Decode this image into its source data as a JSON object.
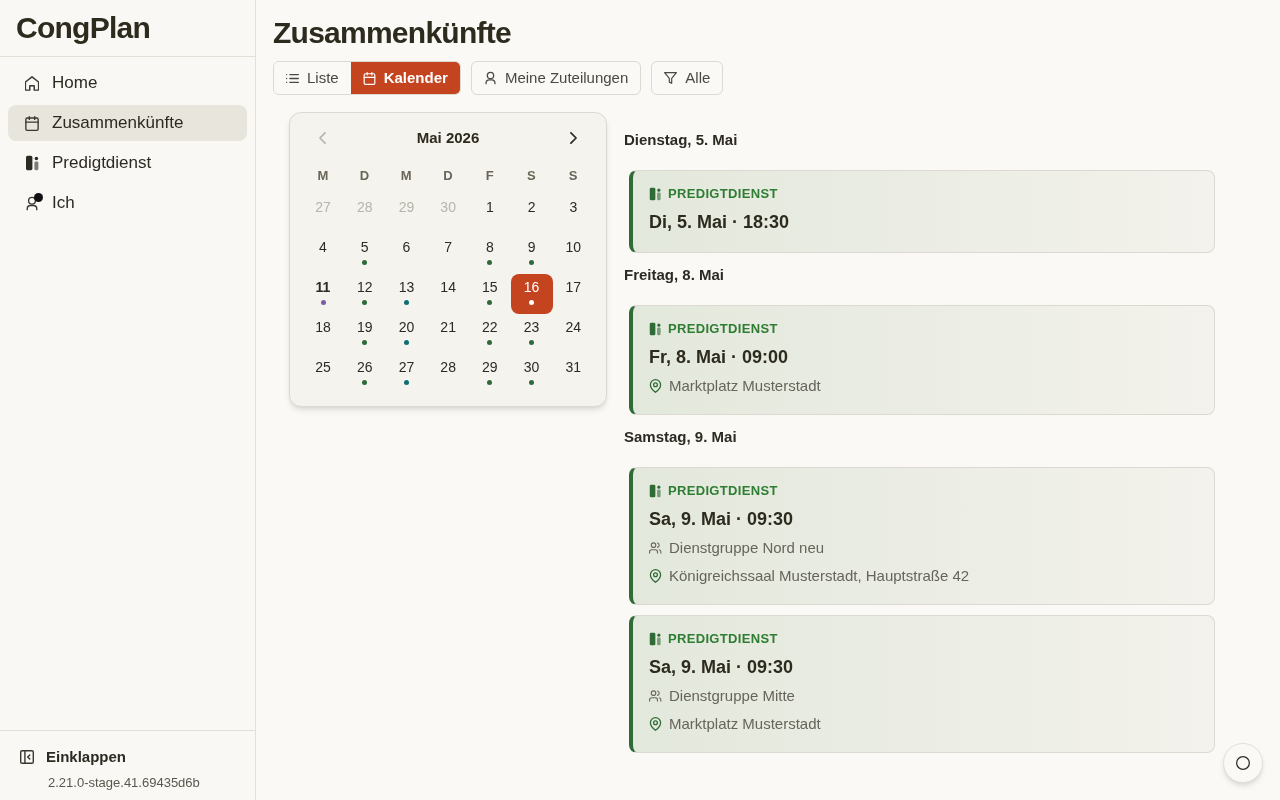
{
  "sidebar": {
    "app_title": "CongPlan",
    "items": [
      {
        "label": "Home",
        "selected": false,
        "notification": false
      },
      {
        "label": "Zusammenkünfte",
        "selected": true,
        "notification": false
      },
      {
        "label": "Predigtdienst",
        "selected": false,
        "notification": false
      },
      {
        "label": "Ich",
        "selected": false,
        "notification": true
      }
    ],
    "collapse_label": "Einklappen",
    "version": "2.21.0-stage.41.69435d6b"
  },
  "page": {
    "title": "Zusammenkünfte"
  },
  "toolbar": {
    "view_toggle": [
      {
        "label": "Liste",
        "selected": false
      },
      {
        "label": "Kalender",
        "selected": true
      }
    ],
    "buttons": [
      {
        "label": "Meine Zuteilungen"
      },
      {
        "label": "Alle"
      }
    ]
  },
  "calendar": {
    "month": "Mai 2026",
    "previous_disabled": true,
    "weekdays": [
      "M",
      "D",
      "M",
      "D",
      "F",
      "S",
      "S"
    ],
    "weeks": [
      [
        {
          "day": "27",
          "outside": true,
          "today": false,
          "selected": false
        },
        {
          "day": "28",
          "outside": true,
          "today": false,
          "selected": false
        },
        {
          "day": "29",
          "outside": true,
          "today": false,
          "selected": false
        },
        {
          "day": "30",
          "outside": true,
          "today": false,
          "selected": false
        },
        {
          "day": "1",
          "outside": false,
          "today": false,
          "selected": false
        },
        {
          "day": "2",
          "outside": false,
          "today": false,
          "selected": false
        },
        {
          "day": "3",
          "outside": false,
          "today": false,
          "selected": false
        }
      ],
      [
        {
          "day": "4",
          "outside": false,
          "today": false,
          "selected": false
        },
        {
          "day": "5",
          "outside": false,
          "today": false,
          "selected": false,
          "color": "#2e6b3a"
        },
        {
          "day": "6",
          "outside": false,
          "today": false,
          "selected": false
        },
        {
          "day": "7",
          "outside": false,
          "today": false,
          "selected": false
        },
        {
          "day": "8",
          "outside": false,
          "today": false,
          "selected": false,
          "color": "#2e6b3a"
        },
        {
          "day": "9",
          "outside": false,
          "today": false,
          "selected": false,
          "color": "#2e6b3a"
        },
        {
          "day": "10",
          "outside": false,
          "today": false,
          "selected": false
        }
      ],
      [
        {
          "day": "11",
          "outside": false,
          "today": true,
          "selected": false,
          "color": "#7e5aa8"
        },
        {
          "day": "12",
          "outside": false,
          "today": false,
          "selected": false,
          "color": "#2e6b3a"
        },
        {
          "day": "13",
          "outside": false,
          "today": false,
          "selected": false,
          "color": "#0f6e74"
        },
        {
          "day": "14",
          "outside": false,
          "today": false,
          "selected": false
        },
        {
          "day": "15",
          "outside": false,
          "today": false,
          "selected": false,
          "color": "#2e6b3a"
        },
        {
          "day": "16",
          "outside": false,
          "today": false,
          "selected": true,
          "color": "#ffffff"
        },
        {
          "day": "17",
          "outside": false,
          "today": false,
          "selected": false
        }
      ],
      [
        {
          "day": "18",
          "outside": false,
          "today": false,
          "selected": false
        },
        {
          "day": "19",
          "outside": false,
          "today": false,
          "selected": false,
          "color": "#2e6b3a"
        },
        {
          "day": "20",
          "outside": false,
          "today": false,
          "selected": false,
          "color": "#0f6e74"
        },
        {
          "day": "21",
          "outside": false,
          "today": false,
          "selected": false
        },
        {
          "day": "22",
          "outside": false,
          "today": false,
          "selected": false,
          "color": "#2e6b3a"
        },
        {
          "day": "23",
          "outside": false,
          "today": false,
          "selected": false,
          "color": "#2e6b3a"
        },
        {
          "day": "24",
          "outside": false,
          "today": false,
          "selected": false
        }
      ],
      [
        {
          "day": "25",
          "outside": false,
          "today": false,
          "selected": false
        },
        {
          "day": "26",
          "outside": false,
          "today": false,
          "selected": false,
          "color": "#2e6b3a"
        },
        {
          "day": "27",
          "outside": false,
          "today": false,
          "selected": false,
          "color": "#0f6e74"
        },
        {
          "day": "28",
          "outside": false,
          "today": false,
          "selected": false
        },
        {
          "day": "29",
          "outside": false,
          "today": false,
          "selected": false,
          "color": "#2e6b3a"
        },
        {
          "day": "30",
          "outside": false,
          "today": false,
          "selected": false,
          "color": "#2e6b3a"
        },
        {
          "day": "31",
          "outside": false,
          "today": false,
          "selected": false
        }
      ]
    ]
  },
  "schedule": {
    "groups": [
      {
        "heading": "Dienstag, 5. Mai",
        "events": [
          {
            "category": "PREDIGTDIENST",
            "title": "Di, 5. Mai · 18:30"
          }
        ]
      },
      {
        "heading": "Freitag, 8. Mai",
        "events": [
          {
            "category": "PREDIGTDIENST",
            "title": "Fr, 8. Mai · 09:00",
            "details": [
              {
                "kind": "location",
                "text": "Marktplatz Musterstadt"
              }
            ]
          }
        ]
      },
      {
        "heading": "Samstag, 9. Mai",
        "events": [
          {
            "category": "PREDIGTDIENST",
            "title": "Sa, 9. Mai · 09:30",
            "details": [
              {
                "kind": "group",
                "text": "Dienstgruppe Nord neu"
              },
              {
                "kind": "location",
                "text": "Königreichssaal Musterstadt, Hauptstraße 42"
              }
            ]
          },
          {
            "category": "PREDIGTDIENST",
            "title": "Sa, 9. Mai · 09:30",
            "details": [
              {
                "kind": "group",
                "text": "Dienstgruppe Mitte"
              },
              {
                "kind": "location",
                "text": "Marktplatz Musterstadt"
              }
            ]
          }
        ]
      }
    ]
  }
}
